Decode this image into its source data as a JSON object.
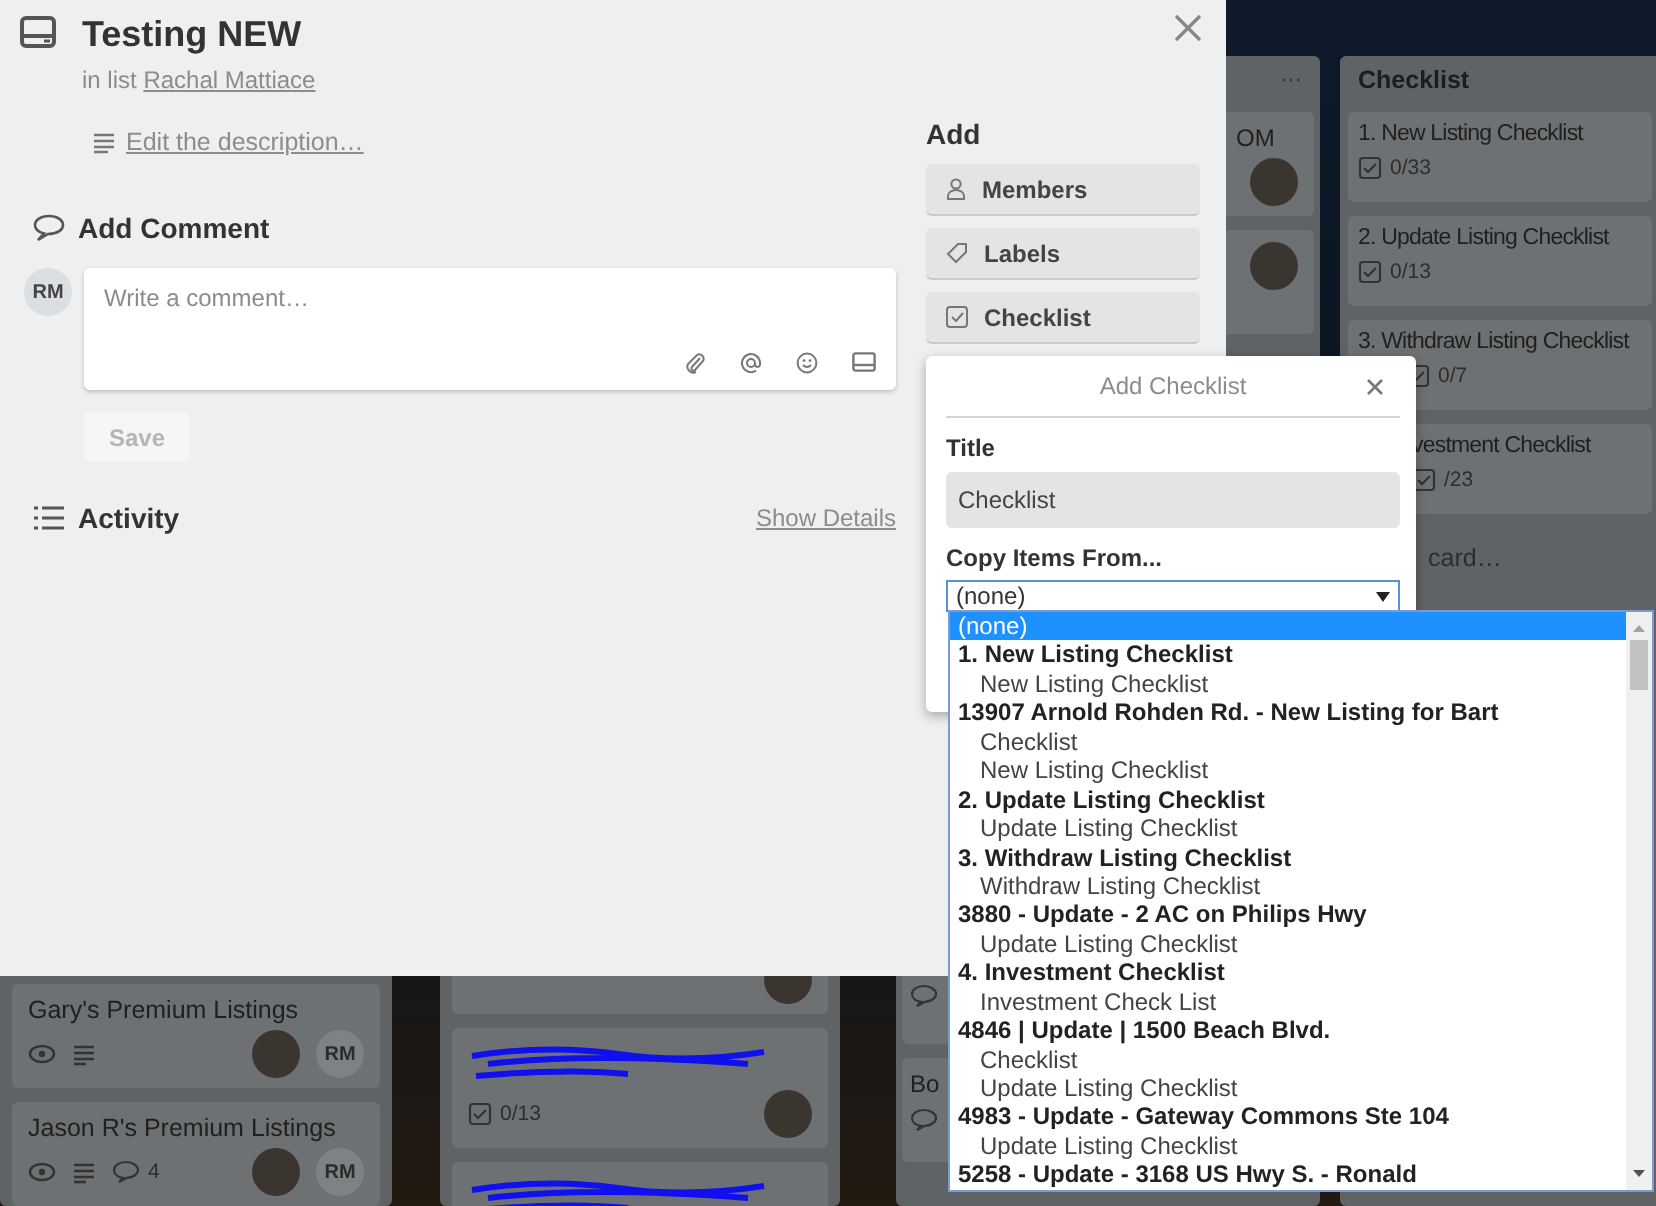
{
  "card": {
    "title": "Testing NEW",
    "list_prefix": "in list",
    "list_name": "Rachal Mattiace",
    "description_link": "Edit the description…",
    "comment": {
      "heading": "Add Comment",
      "avatar": "RM",
      "placeholder": "Write a comment…",
      "save": "Save"
    },
    "activity": {
      "heading": "Activity",
      "show_details": "Show Details"
    },
    "add": {
      "heading": "Add",
      "buttons": [
        {
          "label": "Members",
          "kind": "members"
        },
        {
          "label": "Labels",
          "kind": "labels"
        },
        {
          "label": "Checklist",
          "kind": "checklist"
        }
      ]
    }
  },
  "popover": {
    "title": "Add Checklist",
    "title_label": "Title",
    "title_value": "Checklist",
    "copy_label": "Copy Items From...",
    "select_value": "(none)",
    "options": [
      {
        "kind": "option",
        "label": "(none)",
        "selected": true
      },
      {
        "kind": "group",
        "label": "1. New Listing Checklist",
        "options": [
          {
            "label": "New Listing Checklist",
            "selected": false
          }
        ]
      },
      {
        "kind": "group",
        "label": "13907 Arnold Rohden Rd. - New Listing for Bart",
        "options": [
          {
            "label": "Checklist",
            "selected": false
          },
          {
            "label": "New Listing Checklist",
            "selected": false
          }
        ]
      },
      {
        "kind": "group",
        "label": "2. Update Listing Checklist",
        "options": [
          {
            "label": "Update Listing Checklist",
            "selected": false
          }
        ]
      },
      {
        "kind": "group",
        "label": "3. Withdraw Listing Checklist",
        "options": [
          {
            "label": "Withdraw Listing Checklist",
            "selected": false
          }
        ]
      },
      {
        "kind": "group",
        "label": "3880 - Update - 2 AC on Philips Hwy",
        "options": [
          {
            "label": "Update Listing Checklist",
            "selected": false
          }
        ]
      },
      {
        "kind": "group",
        "label": "4. Investment Checklist",
        "options": [
          {
            "label": "Investment Check List",
            "selected": false
          }
        ]
      },
      {
        "kind": "group",
        "label": "4846 | Update | 1500 Beach Blvd.",
        "options": [
          {
            "label": "Checklist",
            "selected": false
          },
          {
            "label": "Update Listing Checklist",
            "selected": false
          }
        ]
      },
      {
        "kind": "group",
        "label": "4983 - Update - Gateway Commons Ste 104",
        "options": [
          {
            "label": "Update Listing Checklist",
            "selected": false
          }
        ]
      },
      {
        "kind": "group",
        "label": "5258 - Update - 3168 US Hwy S. - Ronald"
      }
    ]
  },
  "board": {
    "lists": [
      {
        "cards": [
          {
            "title": "Gary's Premium Listings",
            "watching": true,
            "description": true,
            "member": "RM",
            "photo": true
          },
          {
            "title": "Jason R's Premium Listings",
            "watching": true,
            "description": true,
            "comments": "4",
            "member": "RM",
            "photo": true
          }
        ]
      },
      {
        "cards": [
          {
            "photo": true
          },
          {
            "redacted": true,
            "checklist": "0/13",
            "photo": true
          },
          {
            "redacted": true
          }
        ]
      },
      {
        "menu": "···",
        "cards": [
          {
            "title": "OM",
            "photo": true
          },
          {
            "photo": true
          },
          {
            "comment_icon": true
          },
          {
            "title": "Bo",
            "comment_icon": true
          }
        ]
      },
      {
        "title": "Checklist",
        "cards": [
          {
            "title": "1. New Listing Checklist",
            "checklist": "0/33"
          },
          {
            "title": "2. Update Listing Checklist",
            "checklist": "0/13"
          },
          {
            "title": "3. Withdraw Listing Checklist",
            "checklist": "0/7"
          },
          {
            "title": "vestment Checklist",
            "checklist": "/23"
          }
        ],
        "add_card": "card…"
      }
    ]
  }
}
